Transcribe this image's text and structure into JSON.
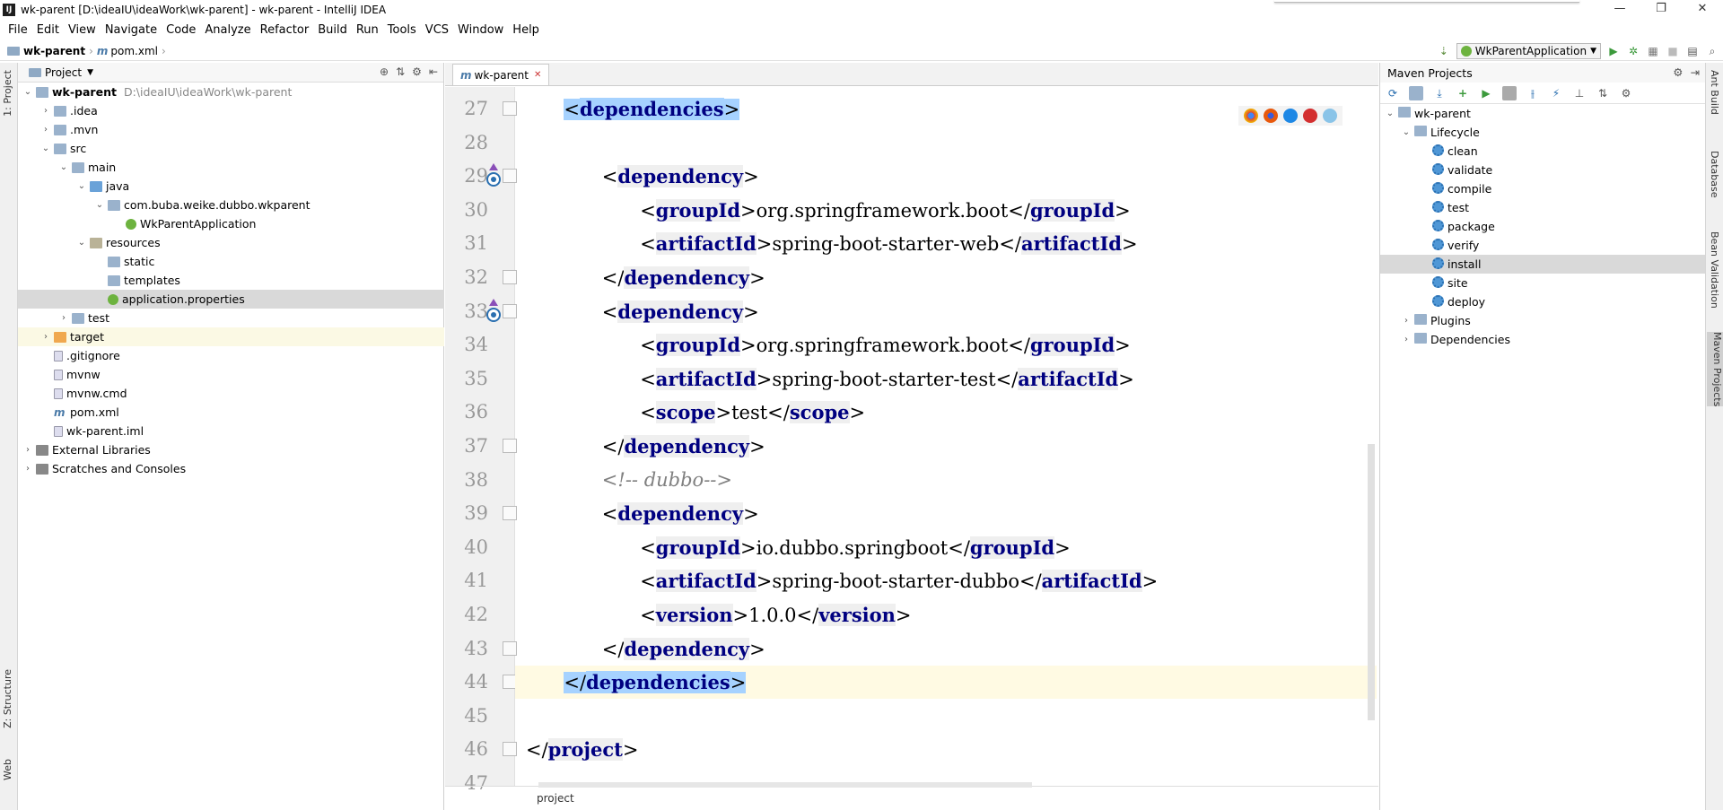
{
  "window": {
    "title": "wk-parent [D:\\ideaIU\\ideaWork\\wk-parent] - wk-parent - IntelliJ IDEA",
    "app_icon": "IJ"
  },
  "menu": [
    "File",
    "Edit",
    "View",
    "Navigate",
    "Code",
    "Analyze",
    "Refactor",
    "Build",
    "Run",
    "Tools",
    "VCS",
    "Window",
    "Help"
  ],
  "breadcrumb": {
    "project": "wk-parent",
    "file": "pom.xml"
  },
  "run_config": {
    "name": "WkParentApplication"
  },
  "left_strip": {
    "project_tab": "1: Project",
    "structure_tab": "Z: Structure",
    "web_tab": "Web"
  },
  "project_panel": {
    "title": "Project",
    "tree": [
      {
        "label": "wk-parent",
        "path": "D:\\ideaIU\\ideaWork\\wk-parent",
        "depth": 0,
        "expanded": true,
        "icon": "folder",
        "bold": true
      },
      {
        "label": ".idea",
        "depth": 1,
        "expanded": false,
        "icon": "folder"
      },
      {
        "label": ".mvn",
        "depth": 1,
        "expanded": false,
        "icon": "folder"
      },
      {
        "label": "src",
        "depth": 1,
        "expanded": true,
        "icon": "folder"
      },
      {
        "label": "main",
        "depth": 2,
        "expanded": true,
        "icon": "folder"
      },
      {
        "label": "java",
        "depth": 3,
        "expanded": true,
        "icon": "folder-src"
      },
      {
        "label": "com.buba.weike.dubbo.wkparent",
        "depth": 4,
        "expanded": true,
        "icon": "folder"
      },
      {
        "label": "WkParentApplication",
        "depth": 5,
        "icon": "spring"
      },
      {
        "label": "resources",
        "depth": 3,
        "expanded": true,
        "icon": "folder-res"
      },
      {
        "label": "static",
        "depth": 4,
        "icon": "folder"
      },
      {
        "label": "templates",
        "depth": 4,
        "icon": "folder"
      },
      {
        "label": "application.properties",
        "depth": 4,
        "icon": "spring",
        "selected": true
      },
      {
        "label": "test",
        "depth": 2,
        "expanded": false,
        "icon": "folder"
      },
      {
        "label": "target",
        "depth": 1,
        "expanded": false,
        "icon": "folder-orange",
        "highlight": true
      },
      {
        "label": ".gitignore",
        "depth": 1,
        "icon": "file"
      },
      {
        "label": "mvnw",
        "depth": 1,
        "icon": "file"
      },
      {
        "label": "mvnw.cmd",
        "depth": 1,
        "icon": "file"
      },
      {
        "label": "pom.xml",
        "depth": 1,
        "icon": "m"
      },
      {
        "label": "wk-parent.iml",
        "depth": 1,
        "icon": "file"
      },
      {
        "label": "External Libraries",
        "depth": 0,
        "expanded": false,
        "icon": "lib"
      },
      {
        "label": "Scratches and Consoles",
        "depth": 0,
        "expanded": false,
        "icon": "lib"
      }
    ]
  },
  "editor": {
    "tab": "wk-parent",
    "status_crumb": "project",
    "lines": [
      {
        "no": "27",
        "indent": 2,
        "parts": [
          {
            "t": "<",
            "c": "br-hl"
          },
          {
            "t": "dependencies",
            "c": "tag-hl"
          },
          {
            "t": ">",
            "c": "br-hl"
          }
        ]
      },
      {
        "no": "28",
        "indent": 0,
        "parts": []
      },
      {
        "no": "29",
        "indent": 4,
        "parts": [
          {
            "t": "<",
            "c": "br"
          },
          {
            "t": "dependency",
            "c": "tag"
          },
          {
            "t": ">",
            "c": "br"
          }
        ]
      },
      {
        "no": "30",
        "indent": 6,
        "parts": [
          {
            "t": "<",
            "c": "br"
          },
          {
            "t": "groupId",
            "c": "tag"
          },
          {
            "t": ">",
            "c": "br"
          },
          {
            "t": "org.springframework.boot",
            "c": "txt"
          },
          {
            "t": "</",
            "c": "br"
          },
          {
            "t": "groupId",
            "c": "tag"
          },
          {
            "t": ">",
            "c": "br"
          }
        ]
      },
      {
        "no": "31",
        "indent": 6,
        "parts": [
          {
            "t": "<",
            "c": "br"
          },
          {
            "t": "artifactId",
            "c": "tag"
          },
          {
            "t": ">",
            "c": "br"
          },
          {
            "t": "spring-boot-starter-web",
            "c": "txt"
          },
          {
            "t": "</",
            "c": "br"
          },
          {
            "t": "artifactId",
            "c": "tag"
          },
          {
            "t": ">",
            "c": "br"
          }
        ]
      },
      {
        "no": "32",
        "indent": 4,
        "parts": [
          {
            "t": "</",
            "c": "br"
          },
          {
            "t": "dependency",
            "c": "tag"
          },
          {
            "t": ">",
            "c": "br"
          }
        ]
      },
      {
        "no": "33",
        "indent": 4,
        "parts": [
          {
            "t": "<",
            "c": "br"
          },
          {
            "t": "dependency",
            "c": "tag"
          },
          {
            "t": ">",
            "c": "br"
          }
        ]
      },
      {
        "no": "34",
        "indent": 6,
        "parts": [
          {
            "t": "<",
            "c": "br"
          },
          {
            "t": "groupId",
            "c": "tag"
          },
          {
            "t": ">",
            "c": "br"
          },
          {
            "t": "org.springframework.boot",
            "c": "txt"
          },
          {
            "t": "</",
            "c": "br"
          },
          {
            "t": "groupId",
            "c": "tag"
          },
          {
            "t": ">",
            "c": "br"
          }
        ]
      },
      {
        "no": "35",
        "indent": 6,
        "parts": [
          {
            "t": "<",
            "c": "br"
          },
          {
            "t": "artifactId",
            "c": "tag"
          },
          {
            "t": ">",
            "c": "br"
          },
          {
            "t": "spring-boot-starter-test",
            "c": "txt"
          },
          {
            "t": "</",
            "c": "br"
          },
          {
            "t": "artifactId",
            "c": "tag"
          },
          {
            "t": ">",
            "c": "br"
          }
        ]
      },
      {
        "no": "36",
        "indent": 6,
        "parts": [
          {
            "t": "<",
            "c": "br"
          },
          {
            "t": "scope",
            "c": "tag"
          },
          {
            "t": ">",
            "c": "br"
          },
          {
            "t": "test",
            "c": "txt"
          },
          {
            "t": "</",
            "c": "br"
          },
          {
            "t": "scope",
            "c": "tag"
          },
          {
            "t": ">",
            "c": "br"
          }
        ]
      },
      {
        "no": "37",
        "indent": 4,
        "parts": [
          {
            "t": "</",
            "c": "br"
          },
          {
            "t": "dependency",
            "c": "tag"
          },
          {
            "t": ">",
            "c": "br"
          }
        ]
      },
      {
        "no": "38",
        "indent": 4,
        "parts": [
          {
            "t": "<!-- dubbo-->",
            "c": "comment"
          }
        ]
      },
      {
        "no": "39",
        "indent": 4,
        "parts": [
          {
            "t": "<",
            "c": "br"
          },
          {
            "t": "dependency",
            "c": "tag"
          },
          {
            "t": ">",
            "c": "br"
          }
        ]
      },
      {
        "no": "40",
        "indent": 6,
        "parts": [
          {
            "t": "<",
            "c": "br"
          },
          {
            "t": "groupId",
            "c": "tag"
          },
          {
            "t": ">",
            "c": "br"
          },
          {
            "t": "io.dubbo.springboot",
            "c": "txt"
          },
          {
            "t": "</",
            "c": "br"
          },
          {
            "t": "groupId",
            "c": "tag"
          },
          {
            "t": ">",
            "c": "br"
          }
        ]
      },
      {
        "no": "41",
        "indent": 6,
        "parts": [
          {
            "t": "<",
            "c": "br"
          },
          {
            "t": "artifactId",
            "c": "tag"
          },
          {
            "t": ">",
            "c": "br"
          },
          {
            "t": "spring-boot-starter-dubbo",
            "c": "txt"
          },
          {
            "t": "</",
            "c": "br"
          },
          {
            "t": "artifactId",
            "c": "tag"
          },
          {
            "t": ">",
            "c": "br"
          }
        ]
      },
      {
        "no": "42",
        "indent": 6,
        "parts": [
          {
            "t": "<",
            "c": "br"
          },
          {
            "t": "version",
            "c": "tag"
          },
          {
            "t": ">",
            "c": "br"
          },
          {
            "t": "1.0.0",
            "c": "txt"
          },
          {
            "t": "</",
            "c": "br"
          },
          {
            "t": "version",
            "c": "tag"
          },
          {
            "t": ">",
            "c": "br"
          }
        ]
      },
      {
        "no": "43",
        "indent": 4,
        "parts": [
          {
            "t": "</",
            "c": "br"
          },
          {
            "t": "dependency",
            "c": "tag"
          },
          {
            "t": ">",
            "c": "br"
          }
        ]
      },
      {
        "no": "44",
        "indent": 2,
        "current": true,
        "parts": [
          {
            "t": "</",
            "c": "br-hl"
          },
          {
            "t": "dependencies",
            "c": "tag-hl"
          },
          {
            "t": ">",
            "c": "br-hl"
          }
        ]
      },
      {
        "no": "45",
        "indent": 0,
        "parts": []
      },
      {
        "no": "46",
        "indent": 0,
        "parts": [
          {
            "t": "</",
            "c": "br"
          },
          {
            "t": "project",
            "c": "tag"
          },
          {
            "t": ">",
            "c": "br"
          }
        ]
      },
      {
        "no": "47",
        "indent": 0,
        "parts": []
      }
    ]
  },
  "maven_panel": {
    "title": "Maven Projects",
    "root": "wk-parent",
    "lifecycle_label": "Lifecycle",
    "lifecycle": [
      "clean",
      "validate",
      "compile",
      "test",
      "package",
      "verify",
      "install",
      "site",
      "deploy"
    ],
    "selected": "install",
    "plugins_label": "Plugins",
    "dependencies_label": "Dependencies"
  },
  "right_strip": {
    "ant": "Ant Build",
    "database": "Database",
    "bean": "Bean Validation",
    "maven": "Maven Projects"
  },
  "colors": {
    "tag": "#000080",
    "selection": "#a6d2ff",
    "current_line": "#fffae3",
    "comment": "#808080"
  }
}
